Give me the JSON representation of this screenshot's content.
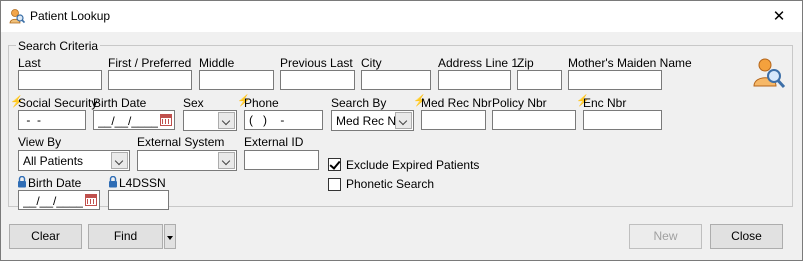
{
  "window": {
    "title": "Patient Lookup",
    "close": "✕"
  },
  "criteria": {
    "legend": "Search Criteria",
    "row1": {
      "last": "Last",
      "first": "First / Preferred",
      "middle": "Middle",
      "previous_last": "Previous Last",
      "city": "City",
      "address1": "Address Line 1",
      "zip": "Zip",
      "mothers_maiden": "Mother's Maiden Name"
    },
    "row2": {
      "ssn": "Social Security",
      "ssn_value": " -  - ",
      "birth_date": "Birth Date",
      "birth_date_value": "__/__/____",
      "sex": "Sex",
      "phone": "Phone",
      "phone_value": "(   )    -",
      "search_by": "Search By",
      "search_by_value": "Med Rec Nbr",
      "med_rec": "Med Rec Nbr",
      "policy": "Policy Nbr",
      "enc": "Enc Nbr"
    },
    "row3": {
      "view_by": "View By",
      "view_by_value": "All Patients",
      "external_system": "External System",
      "external_id": "External ID"
    },
    "row4": {
      "birth_date": "Birth Date",
      "birth_date_value": "__/__/____",
      "l4dssn": "L4DSSN"
    },
    "options": {
      "exclude_expired": "Exclude Expired Patients",
      "exclude_expired_checked": true,
      "phonetic": "Phonetic Search",
      "phonetic_checked": false
    }
  },
  "buttons": {
    "clear": "Clear",
    "find": "Find",
    "new": "New",
    "close": "Close"
  },
  "colors": {
    "bolt": "#d4a100",
    "lock": "#2f6db5",
    "calendar": "#c0504d"
  },
  "icons": [
    "person-search-icon",
    "lightning-icon",
    "lock-icon",
    "calendar-icon"
  ]
}
